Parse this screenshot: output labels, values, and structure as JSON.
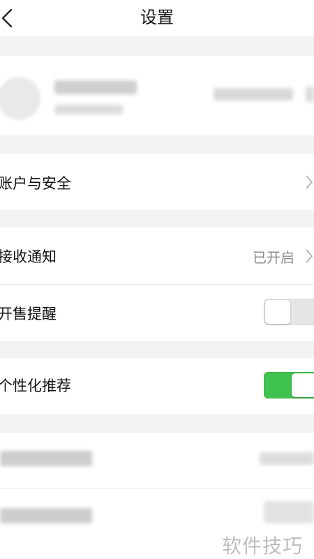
{
  "header": {
    "title": "设置"
  },
  "sections": {
    "account_security": "账户与安全",
    "receive_notifications": "接收通知",
    "receive_notifications_status": "已开启",
    "sale_reminder": "开售提醒",
    "personalized_recommendation": "个性化推荐"
  },
  "toggles": {
    "sale_reminder": "off",
    "personalized_recommendation": "on"
  },
  "watermark": {
    "text": "软件技巧"
  },
  "colors": {
    "background": "#f2f2f2",
    "card": "#ffffff",
    "toggle_on": "#3fc24f",
    "toggle_off": "#e5e5e5",
    "secondary_text": "#8b8b8b"
  }
}
